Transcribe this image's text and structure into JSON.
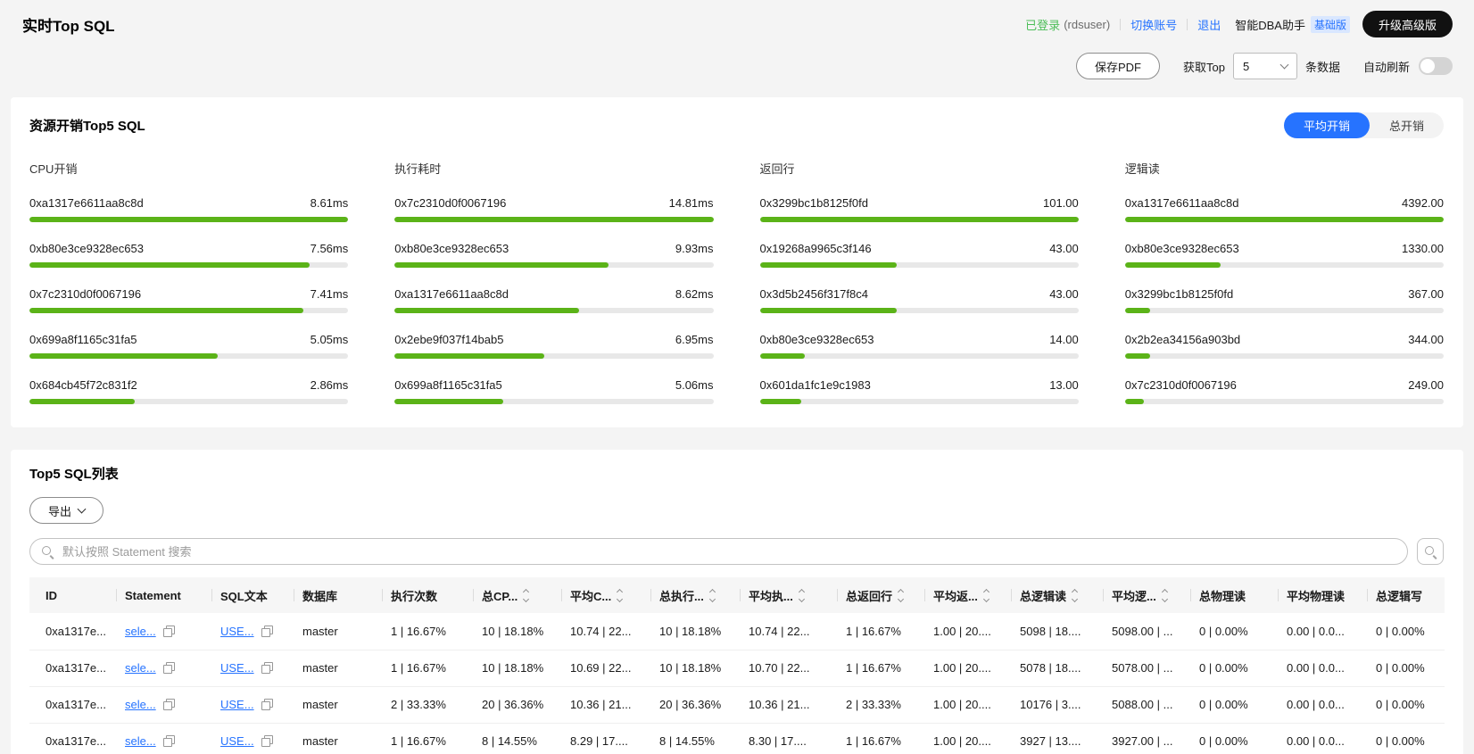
{
  "colors": {
    "accent_blue": "#2673ff",
    "bar_green": "#5bb318",
    "status_green": "#4cbe58",
    "badge_bg": "#d9e7ff"
  },
  "header": {
    "title": "实时Top SQL",
    "login_status": "已登录",
    "login_user": "(rdsuser)",
    "switch_account": "切换账号",
    "logout": "退出",
    "assistant_label": "智能DBA助手",
    "assistant_badge": "基础版",
    "upgrade_button": "升级高级版"
  },
  "toolbar": {
    "save_pdf": "保存PDF",
    "get_top_label": "获取Top",
    "top_count": "5",
    "unit_label": "条数据",
    "auto_refresh_label": "自动刷新",
    "auto_refresh_enabled": false
  },
  "overview": {
    "title": "资源开销Top5 SQL",
    "modes": {
      "average": "平均开销",
      "total": "总开销",
      "active": "平均开销"
    },
    "columns": [
      {
        "title": "CPU开销",
        "items": [
          {
            "id": "0xa1317e6611aa8c8d",
            "value": "8.61ms",
            "pct": 100
          },
          {
            "id": "0xb80e3ce9328ec653",
            "value": "7.56ms",
            "pct": 88
          },
          {
            "id": "0x7c2310d0f0067196",
            "value": "7.41ms",
            "pct": 86
          },
          {
            "id": "0x699a8f1165c31fa5",
            "value": "5.05ms",
            "pct": 59
          },
          {
            "id": "0x684cb45f72c831f2",
            "value": "2.86ms",
            "pct": 33
          }
        ]
      },
      {
        "title": "执行耗时",
        "items": [
          {
            "id": "0x7c2310d0f0067196",
            "value": "14.81ms",
            "pct": 100
          },
          {
            "id": "0xb80e3ce9328ec653",
            "value": "9.93ms",
            "pct": 67
          },
          {
            "id": "0xa1317e6611aa8c8d",
            "value": "8.62ms",
            "pct": 58
          },
          {
            "id": "0x2ebe9f037f14bab5",
            "value": "6.95ms",
            "pct": 47
          },
          {
            "id": "0x699a8f1165c31fa5",
            "value": "5.06ms",
            "pct": 34
          }
        ]
      },
      {
        "title": "返回行",
        "items": [
          {
            "id": "0x3299bc1b8125f0fd",
            "value": "101.00",
            "pct": 100
          },
          {
            "id": "0x19268a9965c3f146",
            "value": "43.00",
            "pct": 43
          },
          {
            "id": "0x3d5b2456f317f8c4",
            "value": "43.00",
            "pct": 43
          },
          {
            "id": "0xb80e3ce9328ec653",
            "value": "14.00",
            "pct": 14
          },
          {
            "id": "0x601da1fc1e9c1983",
            "value": "13.00",
            "pct": 13
          }
        ]
      },
      {
        "title": "逻辑读",
        "items": [
          {
            "id": "0xa1317e6611aa8c8d",
            "value": "4392.00",
            "pct": 100
          },
          {
            "id": "0xb80e3ce9328ec653",
            "value": "1330.00",
            "pct": 30
          },
          {
            "id": "0x3299bc1b8125f0fd",
            "value": "367.00",
            "pct": 8
          },
          {
            "id": "0x2b2ea34156a903bd",
            "value": "344.00",
            "pct": 8
          },
          {
            "id": "0x7c2310d0f0067196",
            "value": "249.00",
            "pct": 6
          }
        ]
      }
    ]
  },
  "sql_list": {
    "title": "Top5 SQL列表",
    "export_label": "导出",
    "search_placeholder": "默认按照 Statement 搜索",
    "table": {
      "headers": [
        {
          "label": "ID",
          "sortable": false
        },
        {
          "label": "Statement",
          "sortable": false
        },
        {
          "label": "SQL文本",
          "sortable": false
        },
        {
          "label": "数据库",
          "sortable": false
        },
        {
          "label": "执行次数",
          "sortable": false
        },
        {
          "label": "总CP...",
          "sortable": true
        },
        {
          "label": "平均C...",
          "sortable": true
        },
        {
          "label": "总执行...",
          "sortable": true
        },
        {
          "label": "平均执...",
          "sortable": true
        },
        {
          "label": "总返回行",
          "sortable": true
        },
        {
          "label": "平均返...",
          "sortable": true
        },
        {
          "label": "总逻辑读",
          "sortable": true
        },
        {
          "label": "平均逻...",
          "sortable": true
        },
        {
          "label": "总物理读",
          "sortable": false
        },
        {
          "label": "平均物理读",
          "sortable": false
        },
        {
          "label": "总逻辑写",
          "sortable": false
        }
      ],
      "rows": [
        {
          "id": "0xa1317e...",
          "statement": "sele...",
          "sql_text": "USE...",
          "database": "master",
          "cells": [
            "1 | 16.67%",
            "10 | 18.18%",
            "10.74 | 22...",
            "10 | 18.18%",
            "10.74 | 22...",
            "1 | 16.67%",
            "1.00 | 20....",
            "5098 | 18....",
            "5098.00 | ...",
            "0 | 0.00%",
            "0.00 | 0.0...",
            "0 | 0.00%"
          ]
        },
        {
          "id": "0xa1317e...",
          "statement": "sele...",
          "sql_text": "USE...",
          "database": "master",
          "cells": [
            "1 | 16.67%",
            "10 | 18.18%",
            "10.69 | 22...",
            "10 | 18.18%",
            "10.70 | 22...",
            "1 | 16.67%",
            "1.00 | 20....",
            "5078 | 18....",
            "5078.00 | ...",
            "0 | 0.00%",
            "0.00 | 0.0...",
            "0 | 0.00%"
          ]
        },
        {
          "id": "0xa1317e...",
          "statement": "sele...",
          "sql_text": "USE...",
          "database": "master",
          "cells": [
            "2 | 33.33%",
            "20 | 36.36%",
            "10.36 | 21...",
            "20 | 36.36%",
            "10.36 | 21...",
            "2 | 33.33%",
            "1.00 | 20....",
            "10176 | 3....",
            "5088.00 | ...",
            "0 | 0.00%",
            "0.00 | 0.0...",
            "0 | 0.00%"
          ]
        },
        {
          "id": "0xa1317e...",
          "statement": "sele...",
          "sql_text": "USE...",
          "database": "master",
          "cells": [
            "1 | 16.67%",
            "8 | 14.55%",
            "8.29 | 17....",
            "8 | 14.55%",
            "8.30 | 17....",
            "1 | 16.67%",
            "1.00 | 20....",
            "3927 | 13....",
            "3927.00 | ...",
            "0 | 0.00%",
            "0.00 | 0.0...",
            "0 | 0.00%"
          ]
        }
      ]
    }
  }
}
